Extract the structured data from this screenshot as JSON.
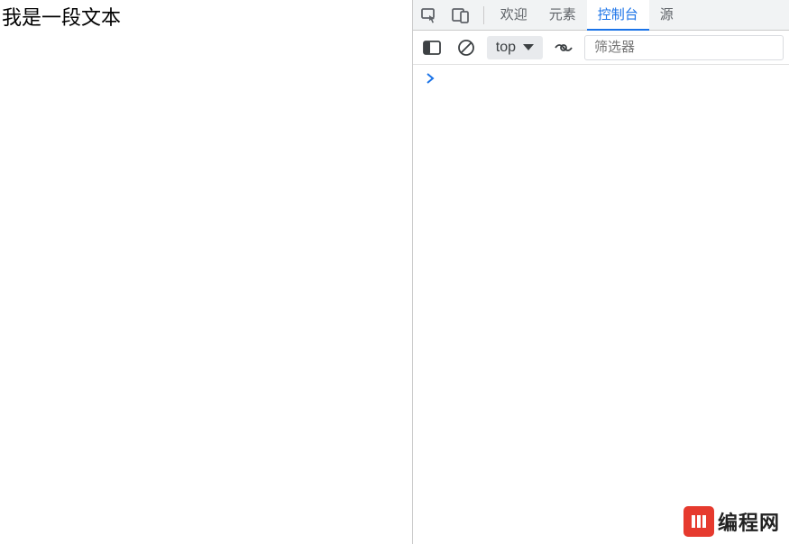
{
  "page": {
    "text": "我是一段文本"
  },
  "devtools": {
    "tabs": {
      "welcome": "欢迎",
      "elements": "元素",
      "console": "控制台",
      "sources_partial": "源"
    },
    "toolbar": {
      "context": "top",
      "filter_placeholder": "筛选器"
    }
  },
  "watermark": {
    "text": "编程网"
  }
}
